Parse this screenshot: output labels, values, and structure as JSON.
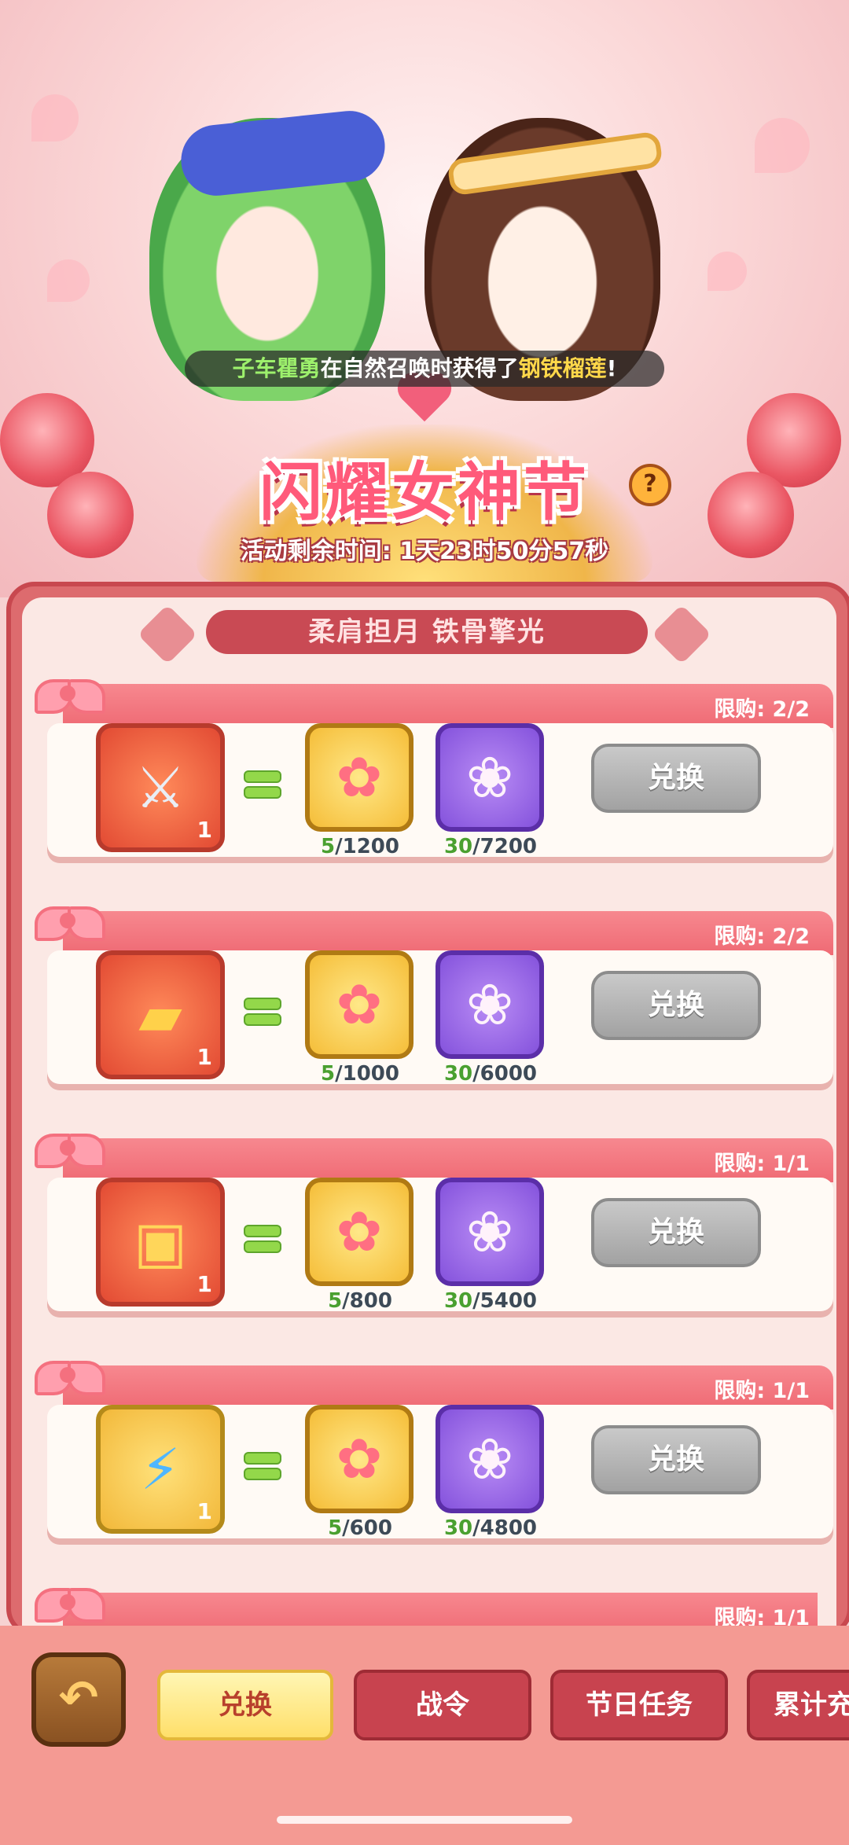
{
  "broadcast": {
    "player": "子车瞿勇",
    "middle": "在自然召唤时获得了",
    "item": "钢铁榴莲",
    "end": "!"
  },
  "event": {
    "title": "闪耀女神节",
    "help": "?",
    "countdown": "活动剩余时间: 1天23时50分57秒",
    "subtitle": "柔肩担月 铁骨擎光"
  },
  "exchange_items": [
    {
      "limit": "限购: 2/2",
      "reward_qty": "1",
      "reward_icon": "robot-mecha-icon",
      "cost1": {
        "have": "5",
        "need": "/1200"
      },
      "cost2": {
        "have": "30",
        "need": "/7200"
      },
      "button": "兑换"
    },
    {
      "limit": "限购: 2/2",
      "reward_qty": "1",
      "reward_icon": "golden-blaster-icon",
      "cost1": {
        "have": "5",
        "need": "/1000"
      },
      "cost2": {
        "have": "30",
        "need": "/6000"
      },
      "button": "兑换"
    },
    {
      "limit": "限购: 1/1",
      "reward_qty": "1",
      "reward_icon": "mystery-chest-icon",
      "cost1": {
        "have": "5",
        "need": "/800"
      },
      "cost2": {
        "have": "30",
        "need": "/5400"
      },
      "button": "兑换"
    },
    {
      "limit": "限购: 1/1",
      "reward_qty": "1",
      "reward_icon": "lightning-card-icon",
      "cost1": {
        "have": "5",
        "need": "/600"
      },
      "cost2": {
        "have": "30",
        "need": "/4800"
      },
      "button": "兑换"
    }
  ],
  "partial_item": {
    "limit": "限购: 1/1"
  },
  "tabs": [
    {
      "label": "兑换",
      "active": true
    },
    {
      "label": "战令",
      "active": false
    },
    {
      "label": "节日任务",
      "active": false
    },
    {
      "label": "累计充",
      "active": false
    }
  ],
  "colors": {
    "accent": "#ef6a74",
    "panel": "#dd6b6e",
    "have_count": "#4aa030",
    "tab_active": "#ffdf6a"
  }
}
